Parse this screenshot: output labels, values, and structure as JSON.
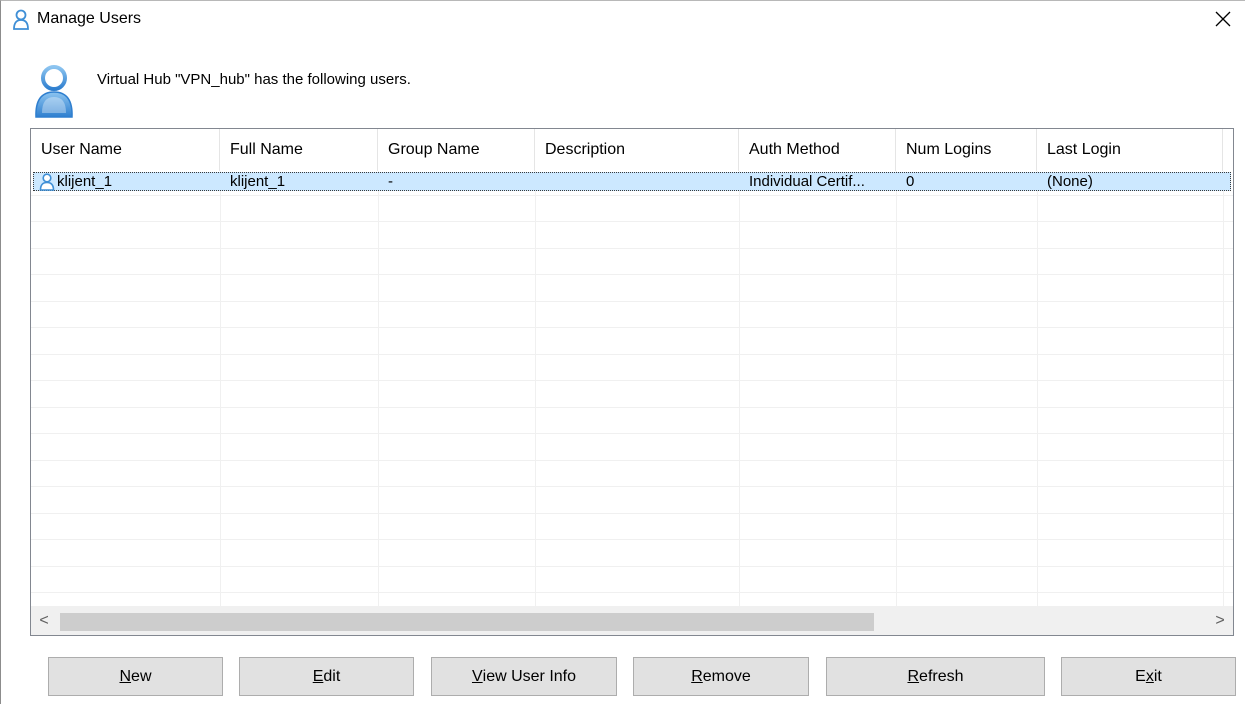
{
  "window": {
    "title": "Manage Users",
    "header_text": "Virtual Hub \"VPN_hub\" has the following users."
  },
  "table": {
    "columns": [
      {
        "label": "User Name"
      },
      {
        "label": "Full Name"
      },
      {
        "label": "Group Name"
      },
      {
        "label": "Description"
      },
      {
        "label": "Auth Method"
      },
      {
        "label": "Num Logins"
      },
      {
        "label": "Last Login"
      }
    ],
    "rows": [
      {
        "user_name": "klijent_1",
        "full_name": "klijent_1",
        "group_name": "-",
        "description": "",
        "auth_method": "Individual Certif...",
        "num_logins": "0",
        "last_login": "(None)",
        "selected": true
      }
    ]
  },
  "scrollbar": {
    "left_arrow": "<",
    "right_arrow": ">"
  },
  "buttons": {
    "new": {
      "pre": "",
      "key": "N",
      "post": "ew"
    },
    "edit": {
      "pre": "",
      "key": "E",
      "post": "dit"
    },
    "view_user_info": {
      "pre": "",
      "key": "V",
      "post": "iew User Info"
    },
    "remove": {
      "pre": "",
      "key": "R",
      "post": "emove"
    },
    "refresh": {
      "pre": "",
      "key": "R",
      "post": "efresh"
    },
    "exit": {
      "pre": "E",
      "key": "x",
      "post": "it"
    }
  },
  "colors": {
    "selection": "#cce8ff",
    "button_face": "#e1e1e1",
    "icon_blue": "#3f8fd6"
  }
}
